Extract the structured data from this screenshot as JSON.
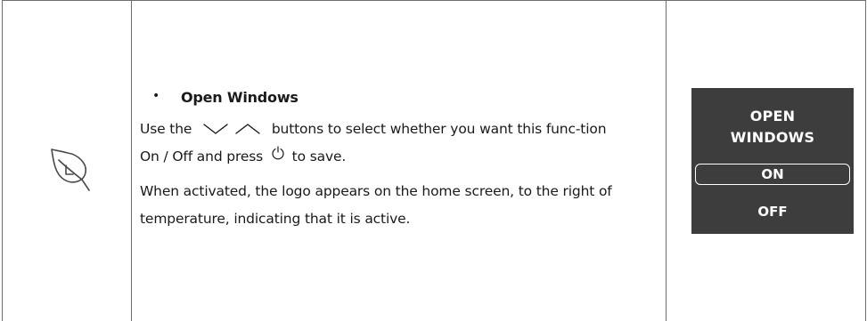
{
  "section": {
    "bullet": "•",
    "heading": "Open Windows",
    "paragraph1": {
      "before": "Use the",
      "icon_down": "chevron-down-icon",
      "icon_up": "chevron-up-icon",
      "middle": "buttons to select whether you want this func-tion On / Off and press",
      "icon_power": "power-icon",
      "after": "to save."
    },
    "paragraph2": "When activated, the logo appears on the home screen, to the right of temperature, indicating that it is active."
  },
  "screen": {
    "title_line1": "OPEN",
    "title_line2": "WINDOWS",
    "option_on": "ON",
    "option_off": "OFF",
    "background": "#3d3d3d",
    "text_color": "#ffffff",
    "selected_option": "ON"
  },
  "icons": {
    "row_icon": "leaf-off-icon"
  },
  "colors": {
    "border": "#6e6e6e",
    "text": "#1a1a1a"
  }
}
